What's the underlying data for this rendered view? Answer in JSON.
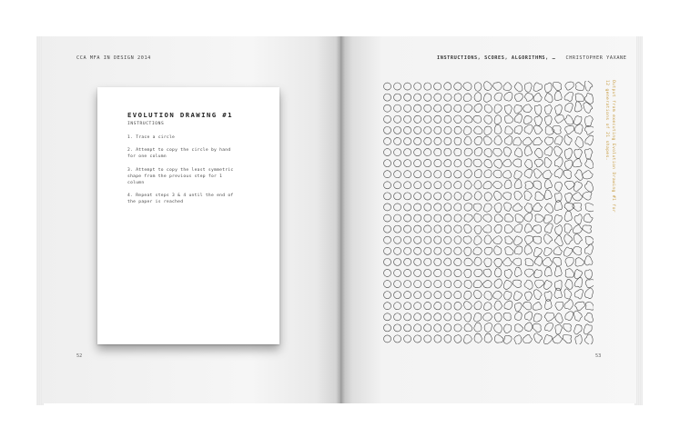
{
  "book": {
    "left_header": "CCA MFA IN DESIGN 2014",
    "right_header_bold": "INSTRUCTIONS, SCORES, ALGORITHMS, …",
    "right_header_author": "CHRISTOPHER YAXANE",
    "left_page_number": "52",
    "right_page_number": "53"
  },
  "card": {
    "title": "EVOLUTION DRAWING #1",
    "subtitle": "INSTRUCTIONS",
    "steps": [
      "1. Trace a circle",
      "2. Attempt to copy the circle by hand\nfor one column",
      "3. Attempt to copy the least symmetric\nshape from the previous step for 1\ncolumn",
      "4. Repeat steps 3 & 4 until the end of\nthe paper is reached"
    ]
  },
  "drawing": {
    "caption": "Output from executing Evolution Drawing #1 for\n12 generations of 21 shapes.",
    "generations": 21,
    "shapes_per_generation": 24,
    "accent_color": "#c69a3e"
  }
}
